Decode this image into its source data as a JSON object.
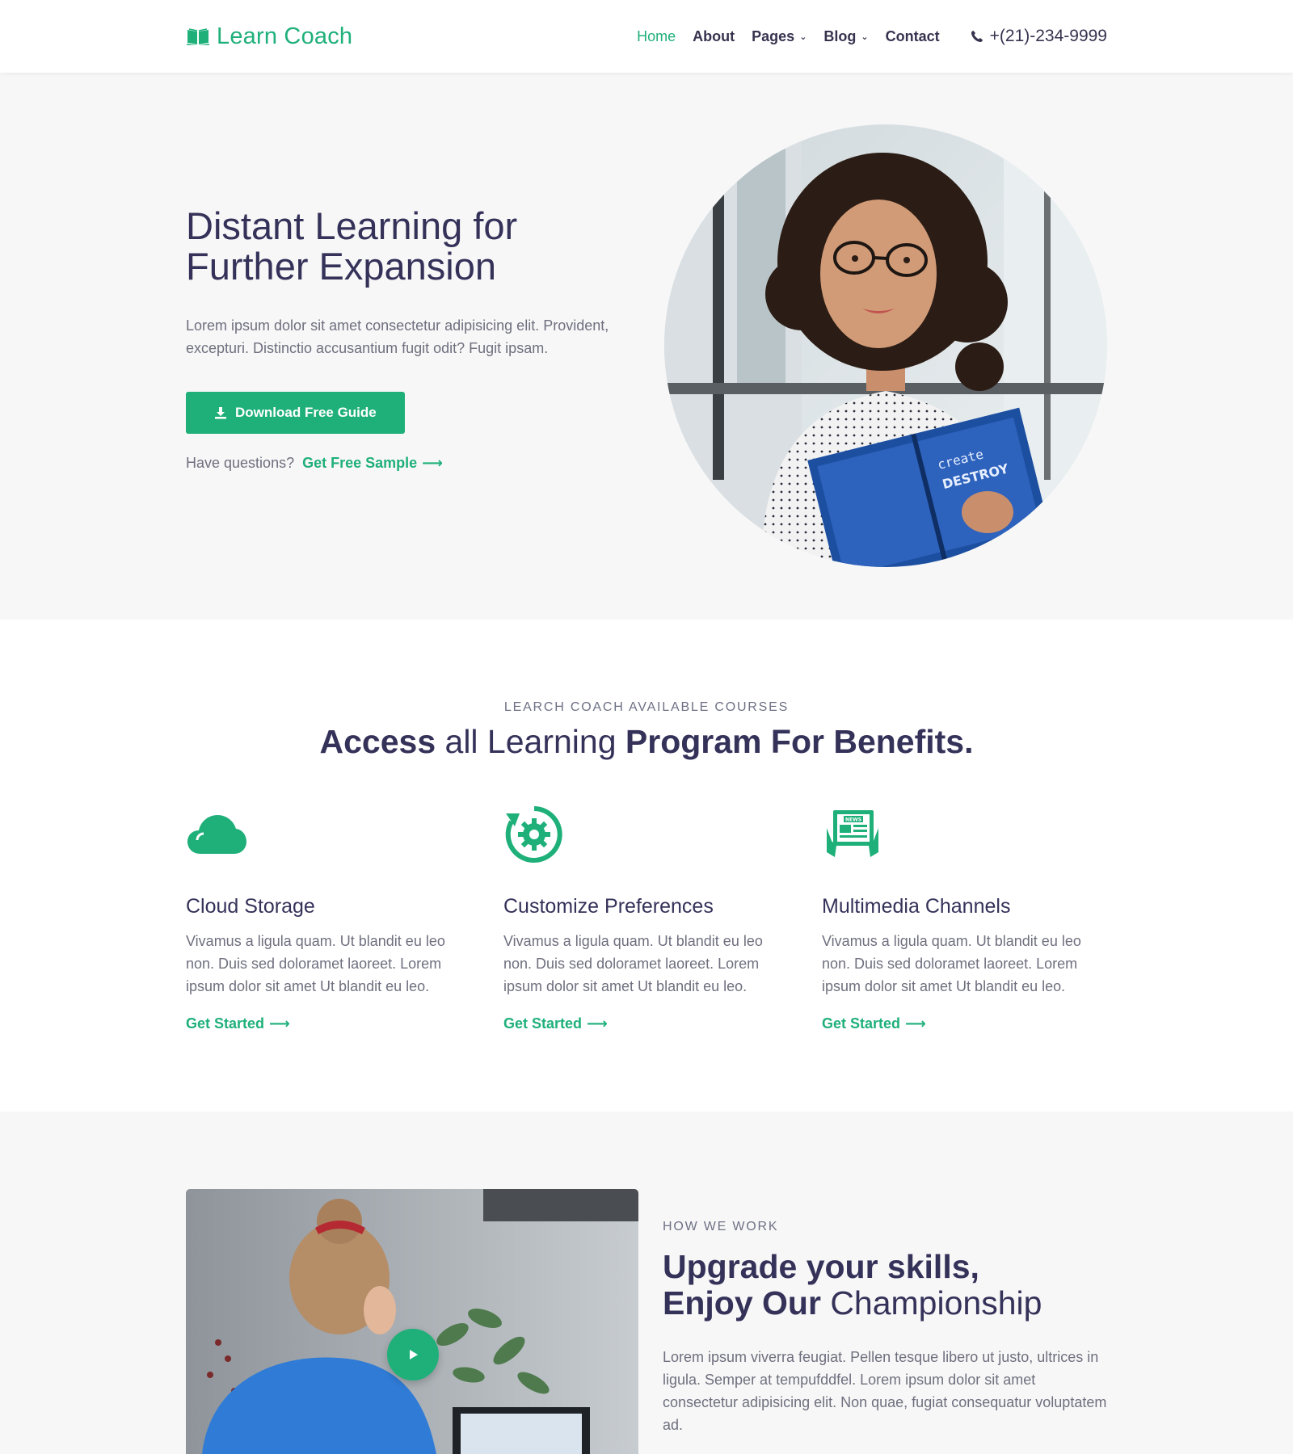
{
  "header": {
    "logo_text": "Learn Coach",
    "nav": [
      {
        "label": "Home",
        "active": true,
        "dropdown": false
      },
      {
        "label": "About",
        "active": false,
        "dropdown": false
      },
      {
        "label": "Pages",
        "active": false,
        "dropdown": true
      },
      {
        "label": "Blog",
        "active": false,
        "dropdown": true
      },
      {
        "label": "Contact",
        "active": false,
        "dropdown": false
      }
    ],
    "phone": "+(21)-234-9999",
    "phone_icon": "phone-icon",
    "logo_icon": "open-book-icon"
  },
  "hero": {
    "title_line1": "Distant Learning for",
    "title_line2": "Further Expansion",
    "description": "Lorem ipsum dolor sit amet consectetur adipisicing elit. Provident, excepturi. Distinctio accusantium fugit odit? Fugit ipsam.",
    "button_label": "Download Free Guide",
    "button_icon": "download-icon",
    "question_text": "Have questions?",
    "sample_link": "Get Free Sample"
  },
  "courses": {
    "eyebrow": "LEARCH COACH AVAILABLE COURSES",
    "title_part1": "Access",
    "title_part2": " all Learning ",
    "title_part3": "Program For Benefits.",
    "cards": [
      {
        "icon": "cloud-icon",
        "title": "Cloud Storage",
        "description": "Vivamus a ligula quam. Ut blandit eu leo non. Duis sed doloramet laoreet. Lorem ipsum dolor sit amet Ut blandit eu leo.",
        "link": "Get Started"
      },
      {
        "icon": "gear-refresh-icon",
        "title": "Customize Preferences",
        "description": "Vivamus a ligula quam. Ut blandit eu leo non. Duis sed doloramet laoreet. Lorem ipsum dolor sit amet Ut blandit eu leo.",
        "link": "Get Started"
      },
      {
        "icon": "newspaper-icon",
        "title": "Multimedia Channels",
        "description": "Vivamus a ligula quam. Ut blandit eu leo non. Duis sed doloramet laoreet. Lorem ipsum dolor sit amet Ut blandit eu leo.",
        "link": "Get Started"
      }
    ],
    "news_badge": "NEWS"
  },
  "how": {
    "eyebrow": "HOW WE WORK",
    "title_line1": "Upgrade your skills,",
    "title_line2_bold": "Enjoy Our",
    "title_line2_light": " Championship",
    "description": "Lorem ipsum viverra feugiat. Pellen tesque libero ut justo, ultrices in ligula. Semper at tempufddfel. Lorem ipsum dolor sit amet consectetur adipisicing elit. Non quae, fugiat consequatur voluptatem ad."
  },
  "colors": {
    "accent": "#1fb07a",
    "heading": "#35325a",
    "body_text": "#6f6f7f",
    "section_bg": "#f7f7f7"
  }
}
